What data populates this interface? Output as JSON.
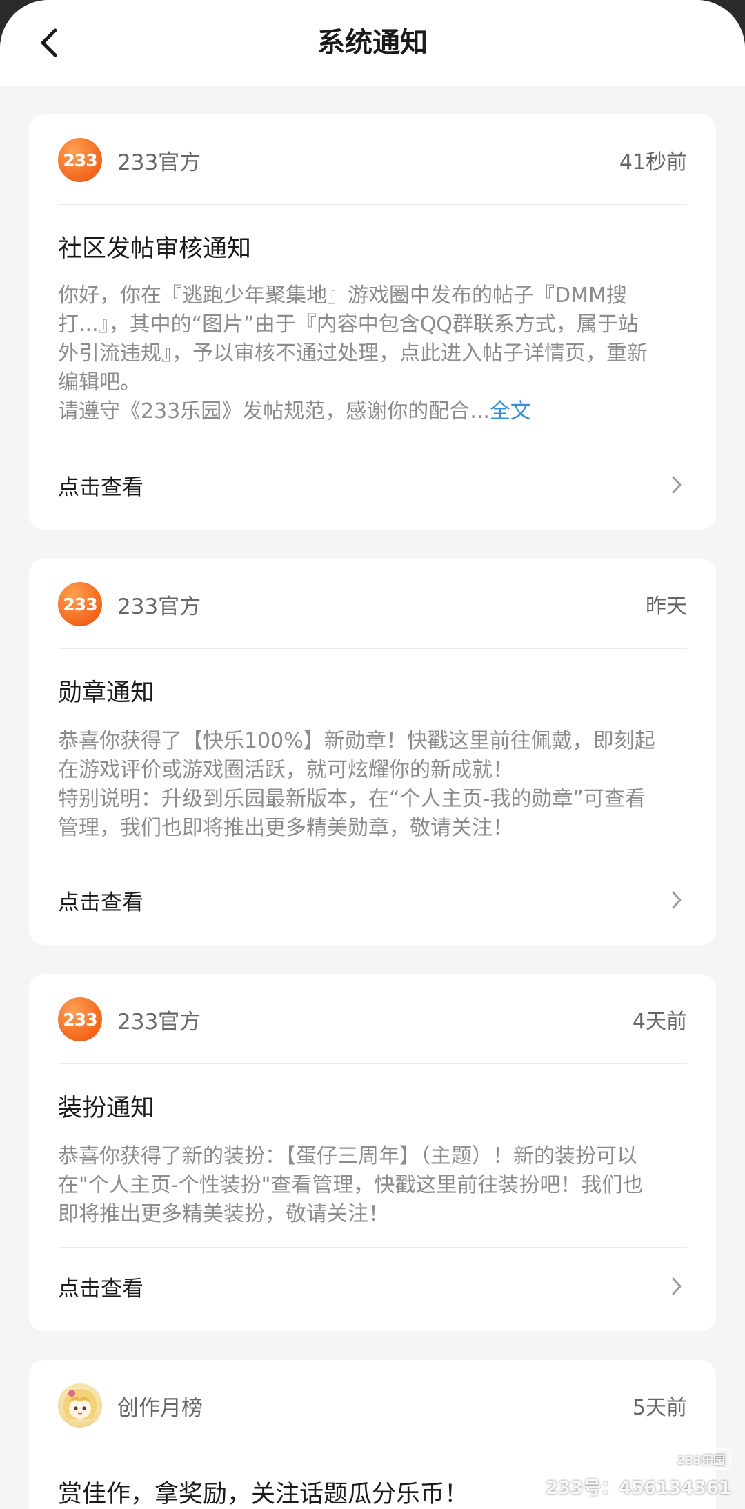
{
  "header": {
    "title": "系统通知"
  },
  "cards": [
    {
      "sender": "233官方",
      "avatar_text": "233",
      "time": "41秒前",
      "title": "社区发帖审核通知",
      "body_lines": [
        "你好，你在『逃跑少年聚集地』游戏圈中发布的帖子『DMM搜",
        "打...』，其中的“图片”由于『内容中包含QQ群联系方式，属于站",
        "外引流违规』，予以审核不通过处理，点此进入帖子详情页，重新",
        "编辑吧。",
        "请遵守《233乐园》发帖规范，感谢你的配合..."
      ],
      "more_label": "全文",
      "action_label": "点击查看"
    },
    {
      "sender": "233官方",
      "avatar_text": "233",
      "time": "昨天",
      "title": "勋章通知",
      "body_lines": [
        "恭喜你获得了【快乐100%】新勋章！快戳这里前往佩戴，即刻起",
        "在游戏评价或游戏圈活跃，就可炫耀你的新成就！",
        "特别说明：升级到乐园最新版本，在“个人主页-我的勋章”可查看",
        "管理，我们也即将推出更多精美勋章，敬请关注！"
      ],
      "action_label": "点击查看"
    },
    {
      "sender": "233官方",
      "avatar_text": "233",
      "time": "4天前",
      "title": "装扮通知",
      "body_lines": [
        "恭喜你获得了新的装扮：【蛋仔三周年】（主题）！新的装扮可以",
        "在\"个人主页-个性装扮\"查看管理，快戳这里前往装扮吧！我们也",
        "即将推出更多精美装扮，敬请关注！"
      ],
      "action_label": "点击查看"
    },
    {
      "sender": "创作月榜",
      "time": "5天前",
      "title": "赏佳作，拿奖励，关注话题瓜分乐币！"
    }
  ],
  "watermark": {
    "logo": "233乐园",
    "id": "233号：456134361"
  },
  "colors": {
    "accent_link": "#3a8fd9",
    "avatar_orange": "#f2661c"
  }
}
